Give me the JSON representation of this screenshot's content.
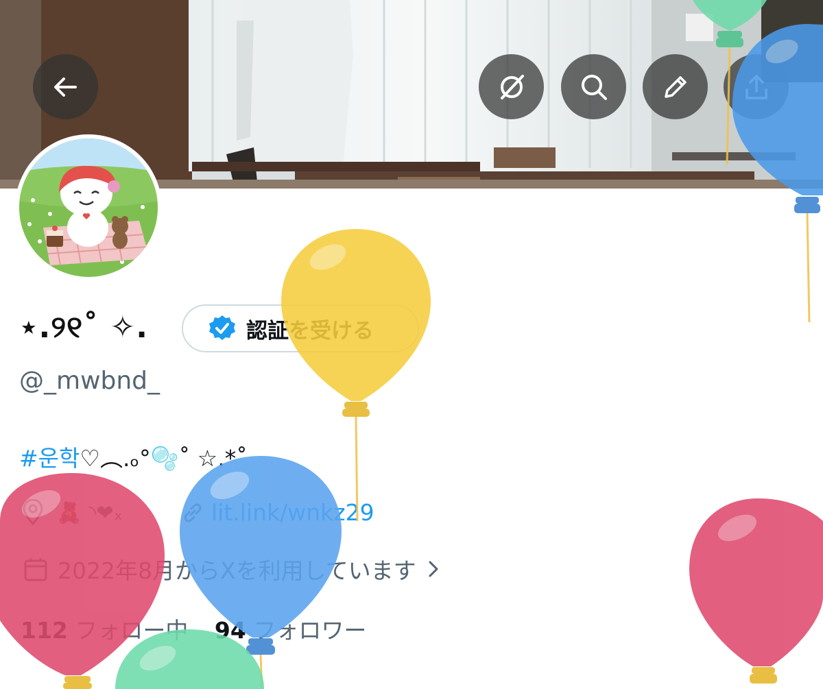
{
  "header": {
    "back_icon": "arrow-left-icon",
    "actions": [
      {
        "name": "grok-icon"
      },
      {
        "name": "search-icon"
      },
      {
        "name": "edit-icon"
      },
      {
        "name": "share-icon"
      }
    ]
  },
  "profile": {
    "display_name": "⋆.୨୧˚ ✧.",
    "verify_label": "認証を受ける",
    "handle": "@_mwbnd_",
    "bio_hashtag": "#운학",
    "bio_rest": "♡︵.ₒ°🫧˚ ☆.*˚",
    "location": "🧸 ◝❤︎ₓ",
    "link": "lit.link/wnkz29",
    "joined": "2022年8月からXを利用しています",
    "following_count": "112",
    "following_label": "フォロー中",
    "followers_count": "94",
    "followers_label": "フォロワー"
  },
  "colors": {
    "accent": "#1d9bf0",
    "secondary_text": "#536471",
    "verified_badge": "#1d9bf0",
    "balloon_yellow": "#f5cd3d",
    "balloon_blue": "#4b9ae8",
    "balloon_red": "#df4a6e",
    "balloon_green": "#6ddbaa"
  }
}
